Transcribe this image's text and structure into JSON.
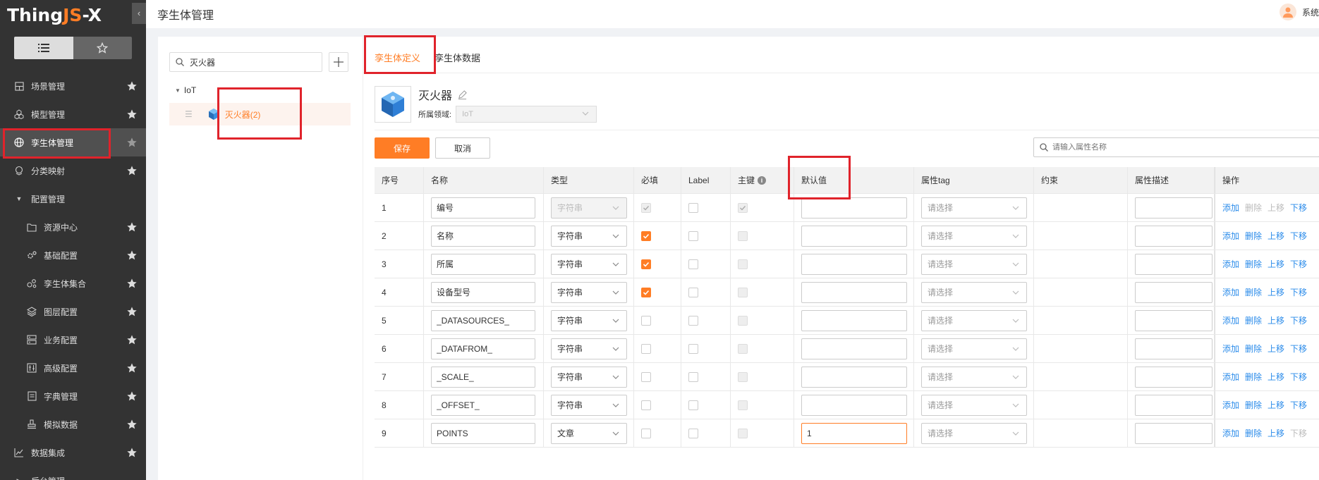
{
  "app": {
    "logo_main": "Thing",
    "logo_accent": "JS",
    "logo_suffix": "-X",
    "page_title": "孪生体管理",
    "user_name": "系统",
    "accent_color": "#ff7d25",
    "link_color": "#2a8bea"
  },
  "sidebar": {
    "items": [
      {
        "label": "场景管理",
        "icon": "grid-icon"
      },
      {
        "label": "模型管理",
        "icon": "cubes-icon"
      },
      {
        "label": "孪生体管理",
        "icon": "globe-icon"
      },
      {
        "label": "分类映射",
        "icon": "map-icon"
      },
      {
        "label": "配置管理",
        "icon": "caret-down-icon"
      },
      {
        "label": "资源中心",
        "icon": "folder-icon"
      },
      {
        "label": "基础配置",
        "icon": "gear-icon"
      },
      {
        "label": "孪生体集合",
        "icon": "nodes-icon"
      },
      {
        "label": "图层配置",
        "icon": "layers-icon"
      },
      {
        "label": "业务配置",
        "icon": "server-icon"
      },
      {
        "label": "高级配置",
        "icon": "sliders-icon"
      },
      {
        "label": "字典管理",
        "icon": "book-icon"
      },
      {
        "label": "模拟数据",
        "icon": "stamp-icon"
      },
      {
        "label": "数据集成",
        "icon": "chart-icon"
      },
      {
        "label": "后台管理",
        "icon": "caret-right-icon"
      }
    ]
  },
  "tree": {
    "search_value": "灭火器",
    "root_label": "IoT",
    "node_label": "灭火器(2)"
  },
  "tabs": [
    "孪生体定义",
    "孪生体数据"
  ],
  "entity": {
    "name": "灭火器",
    "domain_label": "所属领域:",
    "domain_value": "IoT"
  },
  "toolbar": {
    "save_label": "保存",
    "cancel_label": "取消",
    "search_placeholder": "请输入属性名称"
  },
  "table": {
    "headers": [
      "序号",
      "名称",
      "类型",
      "必填",
      "Label",
      "主键",
      "默认值",
      "属性tag",
      "约束",
      "属性描述",
      "操作"
    ],
    "tag_placeholder": "请选择",
    "ops": [
      "添加",
      "删除",
      "上移",
      "下移"
    ],
    "rows": [
      {
        "index": "1",
        "name": "编号",
        "type": "字符串",
        "required": true,
        "pk": true,
        "default": "",
        "type_disabled": true
      },
      {
        "index": "2",
        "name": "名称",
        "type": "字符串",
        "required": true,
        "pk": false,
        "default": ""
      },
      {
        "index": "3",
        "name": "所属",
        "type": "字符串",
        "required": true,
        "pk": false,
        "default": ""
      },
      {
        "index": "4",
        "name": "设备型号",
        "type": "字符串",
        "required": true,
        "pk": false,
        "default": ""
      },
      {
        "index": "5",
        "name": "_DATASOURCES_",
        "type": "字符串",
        "required": false,
        "pk": false,
        "default": ""
      },
      {
        "index": "6",
        "name": "_DATAFROM_",
        "type": "字符串",
        "required": false,
        "pk": false,
        "default": ""
      },
      {
        "index": "7",
        "name": "_SCALE_",
        "type": "字符串",
        "required": false,
        "pk": false,
        "default": ""
      },
      {
        "index": "8",
        "name": "_OFFSET_",
        "type": "字符串",
        "required": false,
        "pk": false,
        "default": ""
      },
      {
        "index": "9",
        "name": "POINTS",
        "type": "文章",
        "required": false,
        "pk": false,
        "default": "1"
      }
    ]
  }
}
